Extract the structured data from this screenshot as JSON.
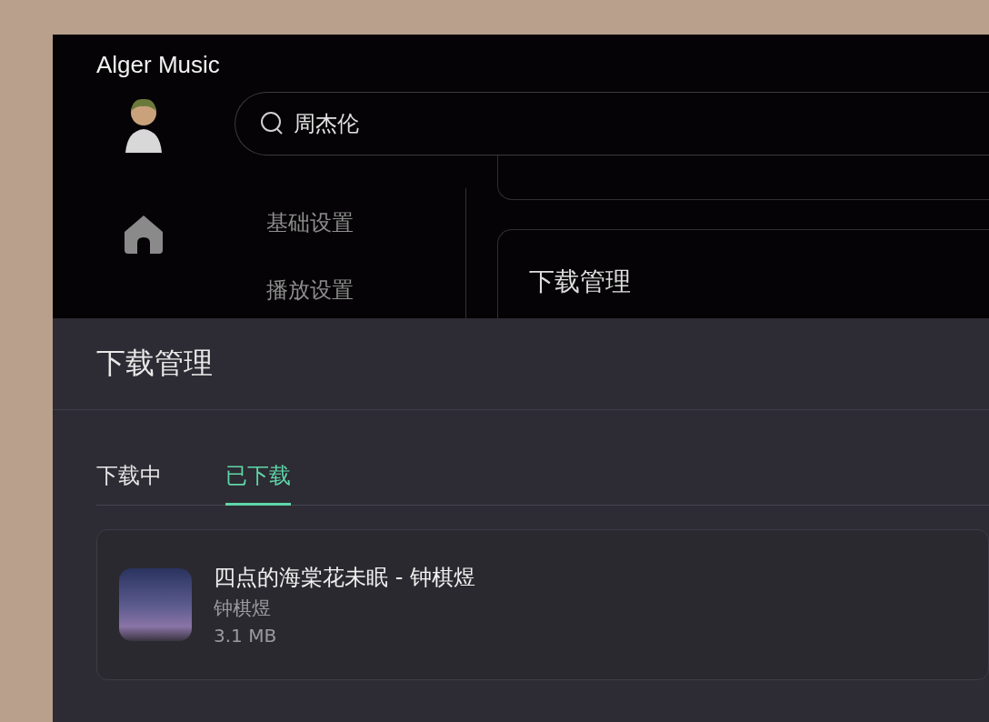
{
  "app": {
    "title": "Alger Music"
  },
  "search": {
    "value": "周杰伦"
  },
  "settings_nav": [
    {
      "label": "基础设置"
    },
    {
      "label": "播放设置"
    }
  ],
  "settings_section": {
    "title": "下载管理"
  },
  "drawer": {
    "title": "下载管理",
    "tabs": [
      {
        "label": "下载中",
        "selected": false
      },
      {
        "label": "已下载",
        "selected": true
      }
    ],
    "items": [
      {
        "title": "四点的海棠花未眠 - 钟棋煜",
        "artist": "钟棋煜",
        "size": "3.1 MB"
      }
    ]
  }
}
